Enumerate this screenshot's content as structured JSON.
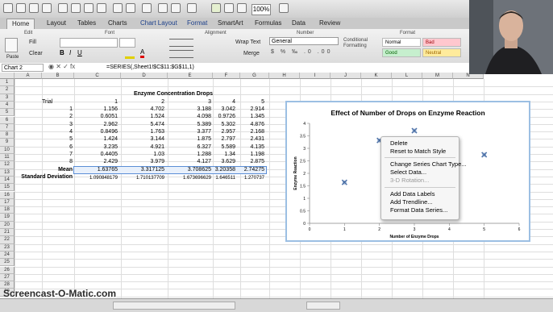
{
  "toolbar": {
    "zoom": "100%"
  },
  "tabs": [
    "Home",
    "Layout",
    "Tables",
    "Charts",
    "Chart Layout",
    "Format",
    "SmartArt",
    "Formulas",
    "Data",
    "Review"
  ],
  "ribbon": {
    "groups": {
      "edit": "Edit",
      "font": "Font",
      "alignment": "Alignment",
      "number": "Number",
      "format": "Format"
    },
    "fill": "Fill",
    "clear": "Clear",
    "paste": "Paste",
    "wrap_text": "Wrap Text",
    "merge": "Merge",
    "number_format": "General",
    "styles": {
      "normal": "Normal",
      "bad": "Bad",
      "good": "Good",
      "neutral": "Neutral"
    },
    "conditional_formatting": "Conditional Formatting"
  },
  "formula_bar": {
    "name_box": "Chart 2",
    "formula": "=SERIES(,Sheet1!$C$11:$G$11,1)"
  },
  "columns": [
    "A",
    "B",
    "C",
    "D",
    "E",
    "F",
    "G",
    "H",
    "I",
    "J",
    "K",
    "L",
    "M",
    "N"
  ],
  "sheet": {
    "title": "Enzyme Concentration Drops",
    "trial_label": "Trial",
    "drops": [
      "1",
      "2",
      "3",
      "4",
      "5"
    ],
    "trials": [
      {
        "n": "1",
        "v": [
          "1.156",
          "4.702",
          "3.188",
          "3.042",
          "2.914"
        ]
      },
      {
        "n": "2",
        "v": [
          "0.6051",
          "1.524",
          "4.098",
          "0.9726",
          "1.345"
        ]
      },
      {
        "n": "3",
        "v": [
          "2.962",
          "5.474",
          "5.389",
          "5.302",
          "4.876"
        ]
      },
      {
        "n": "4",
        "v": [
          "0.8496",
          "1.763",
          "3.377",
          "2.957",
          "2.168"
        ]
      },
      {
        "n": "5",
        "v": [
          "1.424",
          "3.144",
          "1.875",
          "2.797",
          "2.431"
        ]
      },
      {
        "n": "6",
        "v": [
          "3.235",
          "4.921",
          "6.327",
          "5.589",
          "4.135"
        ]
      },
      {
        "n": "7",
        "v": [
          "0.4405",
          "1.03",
          "1.288",
          "1.34",
          "1.198"
        ]
      },
      {
        "n": "8",
        "v": [
          "2.429",
          "3.979",
          "4.127",
          "3.629",
          "2.875"
        ]
      }
    ],
    "mean_label": "Mean",
    "mean": [
      "1.63765",
      "3.317125",
      "3.708625",
      "3.20358",
      "2.74275"
    ],
    "sd_label": "Standard Deviation",
    "sd": [
      "1.090848179",
      "1.710137709",
      "1.673696629",
      "1.646511",
      "1.270737"
    ]
  },
  "chart": {
    "title": "Effect of Number of Drops on Enzyme Reaction",
    "ylabel": "Enzyme Reaction",
    "xlabel": "Number of Enzyme Drops"
  },
  "chart_data": {
    "type": "scatter",
    "title": "Effect of Number of Drops on Enzyme Reaction",
    "xlabel": "Number of Enzyme Drops",
    "ylabel": "Enzyme Reaction",
    "x": [
      1,
      2,
      3,
      4,
      5
    ],
    "y": [
      1.63765,
      3.317125,
      3.708625,
      3.20358,
      2.74275
    ],
    "xlim": [
      0,
      6
    ],
    "ylim": [
      0,
      4
    ],
    "xticks": [
      "0",
      "1",
      "2",
      "3",
      "4",
      "5",
      "6"
    ],
    "yticks": [
      "0",
      "0.5",
      "1",
      "1.5",
      "2",
      "2.5",
      "3",
      "3.5",
      "4"
    ],
    "grid": false
  },
  "context_menu": {
    "items": [
      "Delete",
      "Reset to Match Style",
      "Change Series Chart Type...",
      "Select Data...",
      "3-D Rotation...",
      "Add Data Labels",
      "Add Trendline...",
      "Format Data Series..."
    ],
    "disabled_index": 4
  },
  "watermark": "Screencast-O-Matic.com",
  "colors": {
    "chart_border": "#9cbfe3",
    "marker": "#4a6fa5",
    "good": "#c6efce",
    "bad": "#ffc7ce",
    "neutral": "#ffeb9c"
  }
}
